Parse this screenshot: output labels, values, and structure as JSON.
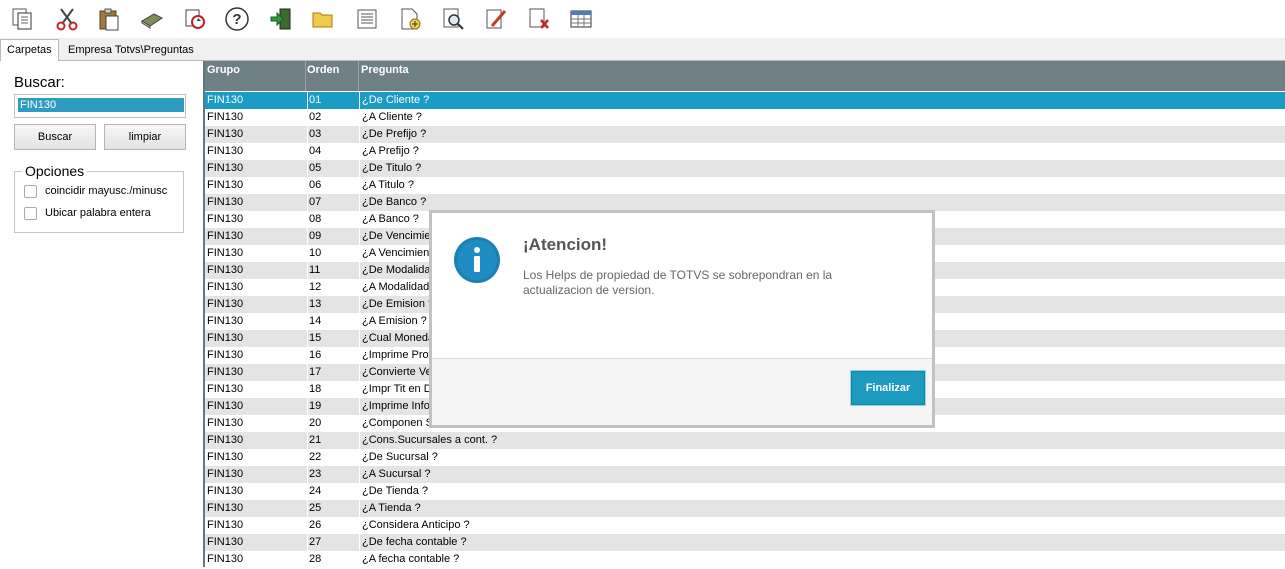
{
  "toolbar": {
    "icons": [
      "copy-icon",
      "cut-icon",
      "paste-icon",
      "book-icon",
      "refresh-icon",
      "help-icon",
      "exit-icon",
      "folder-icon",
      "list-icon",
      "new-document-icon",
      "preview-icon",
      "edit-icon",
      "delete-icon",
      "table-icon"
    ]
  },
  "tabs": [
    "Carpetas",
    "Empresa Totvs\\Preguntas"
  ],
  "search": {
    "title": "Buscar:",
    "value": "FIN130",
    "buscar_button": "Buscar",
    "limpiar_button": "limpiar"
  },
  "opciones": {
    "legend": "Opciones",
    "match_case": "coincidir mayusc./minusc",
    "whole_word": "Ubicar palabra entera"
  },
  "grid": {
    "headers": [
      "Grupo",
      "Orden",
      "Pregunta"
    ],
    "rows": [
      {
        "grupo": "FIN130",
        "orden": "01",
        "pregunta": "¿De Cliente ?"
      },
      {
        "grupo": "FIN130",
        "orden": "02",
        "pregunta": "¿A Cliente ?"
      },
      {
        "grupo": "FIN130",
        "orden": "03",
        "pregunta": "¿De Prefijo ?"
      },
      {
        "grupo": "FIN130",
        "orden": "04",
        "pregunta": "¿A Prefijo ?"
      },
      {
        "grupo": "FIN130",
        "orden": "05",
        "pregunta": "¿De Titulo ?"
      },
      {
        "grupo": "FIN130",
        "orden": "06",
        "pregunta": "¿A Titulo ?"
      },
      {
        "grupo": "FIN130",
        "orden": "07",
        "pregunta": "¿De Banco ?"
      },
      {
        "grupo": "FIN130",
        "orden": "08",
        "pregunta": "¿A Banco ?"
      },
      {
        "grupo": "FIN130",
        "orden": "09",
        "pregunta": "¿De Vencimier"
      },
      {
        "grupo": "FIN130",
        "orden": "10",
        "pregunta": "¿A Vencimient"
      },
      {
        "grupo": "FIN130",
        "orden": "11",
        "pregunta": "¿De Modalidad"
      },
      {
        "grupo": "FIN130",
        "orden": "12",
        "pregunta": "¿A Modalidad"
      },
      {
        "grupo": "FIN130",
        "orden": "13",
        "pregunta": "¿De Emision ?"
      },
      {
        "grupo": "FIN130",
        "orden": "14",
        "pregunta": "¿A Emision ?"
      },
      {
        "grupo": "FIN130",
        "orden": "15",
        "pregunta": "¿Cual Moneda"
      },
      {
        "grupo": "FIN130",
        "orden": "16",
        "pregunta": "¿Imprime Prov"
      },
      {
        "grupo": "FIN130",
        "orden": "17",
        "pregunta": "¿Convierte Ve"
      },
      {
        "grupo": "FIN130",
        "orden": "18",
        "pregunta": "¿Impr Tit en De"
      },
      {
        "grupo": "FIN130",
        "orden": "19",
        "pregunta": "¿Imprime Infor"
      },
      {
        "grupo": "FIN130",
        "orden": "20",
        "pregunta": "¿Componen S"
      },
      {
        "grupo": "FIN130",
        "orden": "21",
        "pregunta": "¿Cons.Sucursales a cont. ?"
      },
      {
        "grupo": "FIN130",
        "orden": "22",
        "pregunta": "¿De Sucursal ?"
      },
      {
        "grupo": "FIN130",
        "orden": "23",
        "pregunta": "¿A Sucursal ?"
      },
      {
        "grupo": "FIN130",
        "orden": "24",
        "pregunta": "¿De Tienda ?"
      },
      {
        "grupo": "FIN130",
        "orden": "25",
        "pregunta": "¿A Tienda ?"
      },
      {
        "grupo": "FIN130",
        "orden": "26",
        "pregunta": "¿Considera Anticipo ?"
      },
      {
        "grupo": "FIN130",
        "orden": "27",
        "pregunta": "¿De fecha contable ?"
      },
      {
        "grupo": "FIN130",
        "orden": "28",
        "pregunta": "¿A fecha contable ?"
      }
    ],
    "selected_index": 0
  },
  "dialog": {
    "title": "¡Atencion!",
    "message": "Los Helps de propiedad de TOTVS se sobrepondran en la actualizacion de version.",
    "button": "Finalizar",
    "icon": "info-icon"
  },
  "colors": {
    "selection": "#1b9cc4",
    "header": "#6e7f86",
    "accent_button": "#1d9ac0"
  }
}
